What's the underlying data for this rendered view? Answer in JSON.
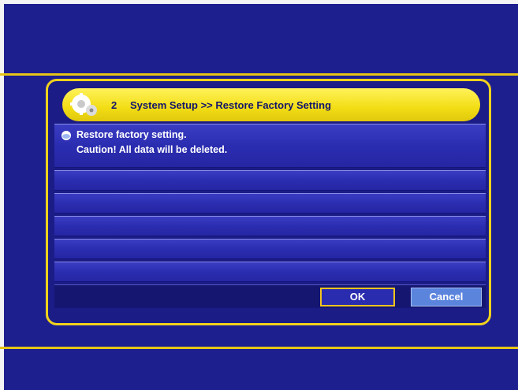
{
  "colors": {
    "background": "#1e1f8f",
    "accent": "#f1d21d",
    "title_bar": "#f2dd14"
  },
  "dialog": {
    "title_icon": "gear-icon",
    "menu_number": "2",
    "title": "System Setup >> Restore Factory Setting",
    "bullet_icon": "bullet-icon",
    "message_line1": "Restore factory setting.",
    "message_line2": "Caution! All data will be deleted.",
    "ok_label": "OK",
    "cancel_label": "Cancel"
  }
}
